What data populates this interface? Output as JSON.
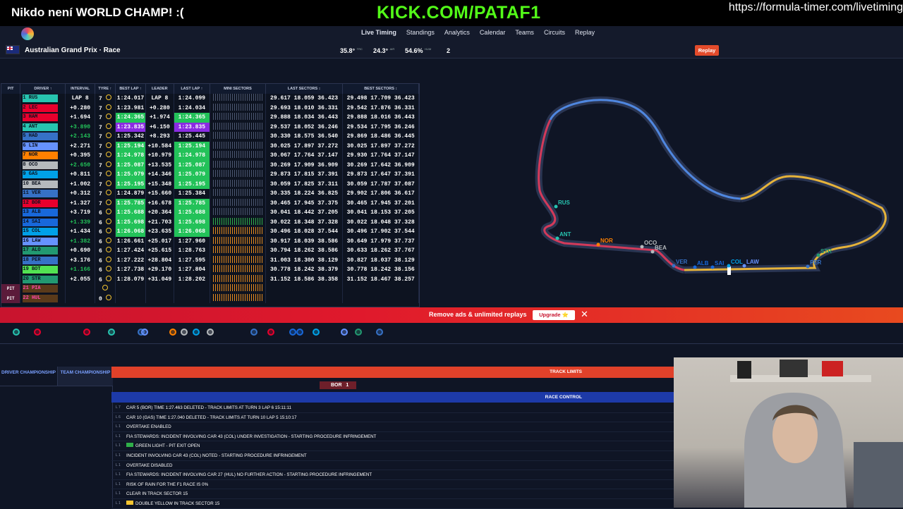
{
  "stream": {
    "message": "Nikdo není WORLD CHAMP! :(",
    "kick": "KICK.COM/PATAF1",
    "url": "https://formula-timer.com/livetiming"
  },
  "nav": [
    "Live Timing",
    "Standings",
    "Analytics",
    "Calendar",
    "Teams",
    "Circuits",
    "Replay"
  ],
  "race": {
    "title": "Australian Grand Prix · Race",
    "track_temp": "35.8°",
    "track_label": "TRC",
    "air_temp": "24.3°",
    "air_label": "AIR",
    "humidity": "54.6%",
    "humidity_label": "HUM",
    "wind": "2",
    "replay_label": "Replay"
  },
  "columns": [
    "PIT",
    "DRIVER ↑",
    "INTERVAL",
    "TYRE ↑",
    "BEST LAP ↑",
    "LEADER",
    "LAST LAP ↑",
    "MINI SECTORS",
    "LAST SECTORS ↕",
    "BEST SECTORS ↕"
  ],
  "drivers": [
    {
      "p": "1",
      "code": "RUS",
      "int": "LAP 8",
      "tyre": "7",
      "best": "1:24.017",
      "leader": "LAP 8",
      "last": "1:24.099",
      "ls": [
        "29.617",
        "18.059",
        "36.423"
      ],
      "bs": [
        "29.498",
        "17.709",
        "36.423"
      ],
      "color": "#27c4b0",
      "hl": "",
      "intc": "#fff"
    },
    {
      "p": "2",
      "code": "LEC",
      "int": "+0.280",
      "tyre": "7",
      "best": "1:23.981",
      "leader": "+0.280",
      "last": "1:24.034",
      "ls": [
        "29.693",
        "18.010",
        "36.331"
      ],
      "bs": [
        "29.542",
        "17.876",
        "36.331"
      ],
      "color": "#e8002d",
      "hl": "",
      "intc": "#fff"
    },
    {
      "p": "3",
      "code": "HAM",
      "int": "+1.694",
      "tyre": "7",
      "best": "1:24.365",
      "leader": "+1.974",
      "last": "1:24.365",
      "ls": [
        "29.888",
        "18.034",
        "36.443"
      ],
      "bs": [
        "29.888",
        "18.016",
        "36.443"
      ],
      "color": "#e8002d",
      "hl": "",
      "intc": "#fff"
    },
    {
      "p": "4",
      "code": "ANT",
      "int": "+3.890",
      "tyre": "7",
      "best": "1:23.835",
      "leader": "+6.150",
      "last": "1:23.835",
      "ls": [
        "29.537",
        "18.052",
        "36.246"
      ],
      "bs": [
        "29.534",
        "17.795",
        "36.246"
      ],
      "color": "#27c4b0",
      "hl": "p",
      "intc": "#23c259"
    },
    {
      "p": "5",
      "code": "HAD",
      "int": "+2.143",
      "tyre": "7",
      "best": "1:25.342",
      "leader": "+8.293",
      "last": "1:25.445",
      "ls": [
        "30.330",
        "18.575",
        "36.540"
      ],
      "bs": [
        "29.869",
        "18.486",
        "36.445"
      ],
      "color": "#3671c6",
      "hl": "",
      "intc": "#23c259"
    },
    {
      "p": "6",
      "code": "LIN",
      "int": "+2.271",
      "tyre": "7",
      "best": "1:25.194",
      "leader": "+10.584",
      "last": "1:25.194",
      "ls": [
        "30.025",
        "17.897",
        "37.272"
      ],
      "bs": [
        "30.025",
        "17.897",
        "37.272"
      ],
      "color": "#6692ff",
      "hl": "",
      "intc": "#fff"
    },
    {
      "p": "7",
      "code": "NOR",
      "int": "+0.395",
      "tyre": "7",
      "best": "1:24.978",
      "leader": "+10.979",
      "last": "1:24.978",
      "ls": [
        "30.067",
        "17.764",
        "37.147"
      ],
      "bs": [
        "29.930",
        "17.764",
        "37.147"
      ],
      "color": "#ff8000",
      "hl": "",
      "intc": "#fff"
    },
    {
      "p": "8",
      "code": "OCO",
      "int": "+2.650",
      "tyre": "7",
      "best": "1:25.087",
      "leader": "+13.535",
      "last": "1:25.087",
      "ls": [
        "30.269",
        "17.909",
        "36.909"
      ],
      "bs": [
        "30.269",
        "17.642",
        "36.909"
      ],
      "color": "#b6babd",
      "hl": "",
      "intc": "#23c259"
    },
    {
      "p": "9",
      "code": "GAS",
      "int": "+0.811",
      "tyre": "7",
      "best": "1:25.079",
      "leader": "+14.346",
      "last": "1:25.079",
      "ls": [
        "29.873",
        "17.815",
        "37.391"
      ],
      "bs": [
        "29.873",
        "17.647",
        "37.391"
      ],
      "color": "#00a1e8",
      "hl": "",
      "intc": "#fff"
    },
    {
      "p": "10",
      "code": "BEA",
      "int": "+1.002",
      "tyre": "7",
      "best": "1:25.195",
      "leader": "+15.348",
      "last": "1:25.195",
      "ls": [
        "30.059",
        "17.825",
        "37.311"
      ],
      "bs": [
        "30.059",
        "17.787",
        "37.087"
      ],
      "color": "#b6babd",
      "hl": "",
      "intc": "#fff"
    },
    {
      "p": "11",
      "code": "VER",
      "int": "+0.312",
      "tyre": "7",
      "best": "1:24.879",
      "leader": "+15.660",
      "last": "1:25.384",
      "ls": [
        "30.335",
        "18.224",
        "36.825"
      ],
      "bs": [
        "29.902",
        "17.806",
        "36.617"
      ],
      "color": "#3671c6",
      "hl": "",
      "intc": "#fff"
    },
    {
      "p": "12",
      "code": "BOR",
      "int": "+1.327",
      "tyre": "7",
      "best": "1:25.785",
      "leader": "+16.678",
      "last": "1:25.785",
      "ls": [
        "30.465",
        "17.945",
        "37.375"
      ],
      "bs": [
        "30.465",
        "17.945",
        "37.201"
      ],
      "color": "#e8002d",
      "hl": "",
      "intc": "#fff"
    },
    {
      "p": "13",
      "code": "ALB",
      "int": "+3.719",
      "tyre": "6",
      "best": "1:25.688",
      "leader": "+20.364",
      "last": "1:25.688",
      "ls": [
        "30.041",
        "18.442",
        "37.205"
      ],
      "bs": [
        "30.041",
        "18.153",
        "37.205"
      ],
      "color": "#1868db",
      "hl": "",
      "intc": "#fff"
    },
    {
      "p": "14",
      "code": "SAI",
      "int": "+1.339",
      "tyre": "6",
      "best": "1:25.698",
      "leader": "+21.703",
      "last": "1:25.698",
      "ls": [
        "30.022",
        "18.348",
        "37.328"
      ],
      "bs": [
        "30.022",
        "18.048",
        "37.328"
      ],
      "color": "#1868db",
      "hl": "",
      "intc": "#23c259"
    },
    {
      "p": "15",
      "code": "COL",
      "int": "+1.434",
      "tyre": "6",
      "best": "1:26.068",
      "leader": "+23.635",
      "last": "1:26.068",
      "ls": [
        "30.496",
        "18.028",
        "37.544"
      ],
      "bs": [
        "30.496",
        "17.902",
        "37.544"
      ],
      "color": "#00a1e8",
      "hl": "",
      "intc": "#fff"
    },
    {
      "p": "16",
      "code": "LAW",
      "int": "+1.382",
      "tyre": "6",
      "best": "1:26.661",
      "leader": "+25.017",
      "last": "1:27.960",
      "ls": [
        "30.917",
        "18.039",
        "38.586"
      ],
      "bs": [
        "30.649",
        "17.979",
        "37.737"
      ],
      "color": "#6692ff",
      "hl": "",
      "intc": "#23c259"
    },
    {
      "p": "17",
      "code": "ALO",
      "int": "+0.690",
      "tyre": "6",
      "best": "1:27.424",
      "leader": "+25.615",
      "last": "1:28.763",
      "ls": [
        "30.794",
        "18.262",
        "38.586"
      ],
      "bs": [
        "30.633",
        "18.262",
        "37.767"
      ],
      "color": "#229971",
      "hl": "",
      "intc": "#fff"
    },
    {
      "p": "18",
      "code": "PER",
      "int": "+3.176",
      "tyre": "6",
      "best": "1:27.222",
      "leader": "+28.804",
      "last": "1:27.595",
      "ls": [
        "31.003",
        "18.300",
        "38.129"
      ],
      "bs": [
        "30.827",
        "18.037",
        "38.129"
      ],
      "color": "#3671c6",
      "hl": "",
      "intc": "#fff"
    },
    {
      "p": "19",
      "code": "BOT",
      "int": "+1.166",
      "tyre": "6",
      "best": "1:27.738",
      "leader": "+29.170",
      "last": "1:27.804",
      "ls": [
        "30.778",
        "18.242",
        "38.379"
      ],
      "bs": [
        "30.778",
        "18.242",
        "38.156"
      ],
      "color": "#52e252",
      "hl": "",
      "intc": "#23c259"
    },
    {
      "p": "20",
      "code": "STR",
      "int": "+2.055",
      "tyre": "6",
      "best": "1:28.079",
      "leader": "+31.049",
      "last": "1:28.202",
      "ls": [
        "31.152",
        "18.586",
        "38.358"
      ],
      "bs": [
        "31.152",
        "18.467",
        "38.257"
      ],
      "color": "#229971",
      "hl": "",
      "intc": "#fff"
    },
    {
      "p": "21",
      "code": "PIA",
      "int": "",
      "tyre": "",
      "best": "",
      "leader": "",
      "last": "",
      "ls": [
        "",
        "",
        ""
      ],
      "bs": [
        "",
        "",
        ""
      ],
      "color": "#ff8000",
      "hl": "",
      "intc": "#fff"
    },
    {
      "p": "22",
      "code": "HUL",
      "int": "",
      "tyre": "0",
      "best": "",
      "leader": "",
      "last": "",
      "ls": [
        "",
        "",
        ""
      ],
      "bs": [
        "",
        "",
        ""
      ],
      "color": "#52e252",
      "hl": "",
      "intc": "#fff"
    }
  ],
  "pit_label": "PIT",
  "track_labels": [
    "RUS",
    "ANT",
    "NOR",
    "OCO",
    "BEA",
    "VER",
    "ALB",
    "SAI",
    "COL",
    "LAW",
    "PER",
    "STR"
  ],
  "banner": {
    "text": "Remove ads & unlimited replays",
    "upgrade": "Upgrade ⭐",
    "close": "✕"
  },
  "tabs": {
    "driver": "DRIVER CHAMPIONSHIP",
    "team": "TEAM CHAMPIONSHIP"
  },
  "track_limits": {
    "header": "TRACK LIMITS",
    "badge_driver": "BOR",
    "badge_count": "1"
  },
  "race_control": {
    "header": "RACE CONTROL",
    "messages": [
      {
        "lap": "L 7",
        "text": "CAR 5 (BOR) TIME 1:27.463 DELETED - TRACK LIMITS AT TURN 3 LAP 6 15:11:11",
        "flag": ""
      },
      {
        "lap": "L 6",
        "text": "CAR 10 (GAS) TIME 1:27.040 DELETED - TRACK LIMITS AT TURN 10 LAP 5 15:10:17",
        "flag": ""
      },
      {
        "lap": "L 1",
        "text": "OVERTAKE ENABLED",
        "flag": ""
      },
      {
        "lap": "L 1",
        "text": "FIA STEWARDS: INCIDENT INVOLVING CAR 43 (COL) UNDER INVESTIGATION - STARTING PROCEDURE INFRINGEMENT",
        "flag": ""
      },
      {
        "lap": "L 1",
        "text": "GREEN LIGHT - PIT EXIT OPEN",
        "flag": "green"
      },
      {
        "lap": "L 1",
        "text": "INCIDENT INVOLVING CAR 43 (COL) NOTED - STARTING PROCEDURE INFRINGEMENT",
        "flag": ""
      },
      {
        "lap": "L 1",
        "text": "OVERTAKE DISABLED",
        "flag": ""
      },
      {
        "lap": "L 1",
        "text": "FIA STEWARDS: INCIDENT INVOLVING CAR 27 (HUL) NO FURTHER ACTION - STARTING PROCEDURE INFRINGEMENT",
        "flag": ""
      },
      {
        "lap": "L 1",
        "text": "RISK OF RAIN FOR THE F1 RACE IS 0%",
        "flag": ""
      },
      {
        "lap": "L 1",
        "text": "CLEAR IN TRACK SECTOR 15",
        "flag": ""
      },
      {
        "lap": "L 1",
        "text": "DOUBLE YELLOW IN TRACK SECTOR 15",
        "flag": "yellow"
      }
    ]
  }
}
